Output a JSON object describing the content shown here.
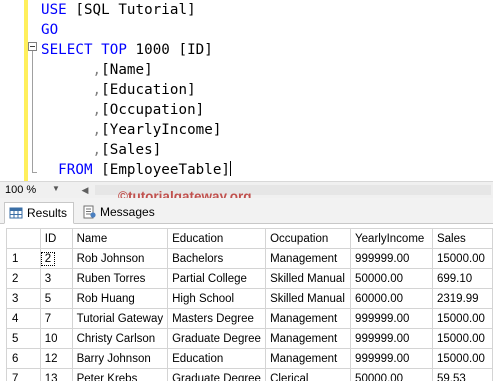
{
  "editor": {
    "lines": [
      {
        "parts": [
          {
            "text": "USE",
            "cls": "kw"
          },
          {
            "text": " [SQL Tutorial]",
            "cls": "blk"
          }
        ]
      },
      {
        "parts": [
          {
            "text": "GO",
            "cls": "kw"
          }
        ]
      },
      {
        "parts": [
          {
            "text": "SELECT TOP",
            "cls": "kw"
          },
          {
            "text": " 1000 [ID]",
            "cls": "blk"
          }
        ]
      },
      {
        "parts": [
          {
            "text": "      ,",
            "cls": "gray"
          },
          {
            "text": "[Name]",
            "cls": "blk"
          }
        ]
      },
      {
        "parts": [
          {
            "text": "      ,",
            "cls": "gray"
          },
          {
            "text": "[Education]",
            "cls": "blk"
          }
        ]
      },
      {
        "parts": [
          {
            "text": "      ,",
            "cls": "gray"
          },
          {
            "text": "[Occupation]",
            "cls": "blk"
          }
        ]
      },
      {
        "parts": [
          {
            "text": "      ,",
            "cls": "gray"
          },
          {
            "text": "[YearlyIncome]",
            "cls": "blk"
          }
        ]
      },
      {
        "parts": [
          {
            "text": "      ,",
            "cls": "gray"
          },
          {
            "text": "[Sales]",
            "cls": "blk"
          }
        ]
      },
      {
        "parts": [
          {
            "text": "  FROM",
            "cls": "kw"
          },
          {
            "text": " [EmployeeTable]",
            "cls": "blk"
          }
        ]
      }
    ]
  },
  "zoom": {
    "value": "100 %"
  },
  "watermark": "©tutorialgateway.org",
  "tabs": {
    "results": "Results",
    "messages": "Messages"
  },
  "grid": {
    "columns": [
      "ID",
      "Name",
      "Education",
      "Occupation",
      "YearlyIncome",
      "Sales"
    ],
    "rows": [
      [
        "1",
        "2",
        "Rob Johnson",
        "Bachelors",
        "Management",
        "999999.00",
        "15000.00"
      ],
      [
        "2",
        "3",
        "Ruben Torres",
        "Partial College",
        "Skilled Manual",
        "50000.00",
        "699.10"
      ],
      [
        "3",
        "5",
        "Rob Huang",
        "High School",
        "Skilled Manual",
        "60000.00",
        "2319.99"
      ],
      [
        "4",
        "7",
        "Tutorial Gateway",
        "Masters Degree",
        "Management",
        "999999.00",
        "15000.00"
      ],
      [
        "5",
        "10",
        "Christy Carlson",
        "Graduate Degree",
        "Management",
        "999999.00",
        "15000.00"
      ],
      [
        "6",
        "12",
        "Barry Johnson",
        "Education",
        "Management",
        "999999.00",
        "15000.00"
      ],
      [
        "7",
        "13",
        "Peter Krebs",
        "Graduate Degree",
        "Clerical",
        "50000.00",
        "59.53"
      ]
    ]
  },
  "colors": {
    "keyword": "#0000ff",
    "watermark": "#c0504d",
    "gutter": "#ffef5c"
  },
  "icons": {
    "results": "grid-icon",
    "messages": "messages-icon",
    "zoom": "chevron-down-icon"
  }
}
